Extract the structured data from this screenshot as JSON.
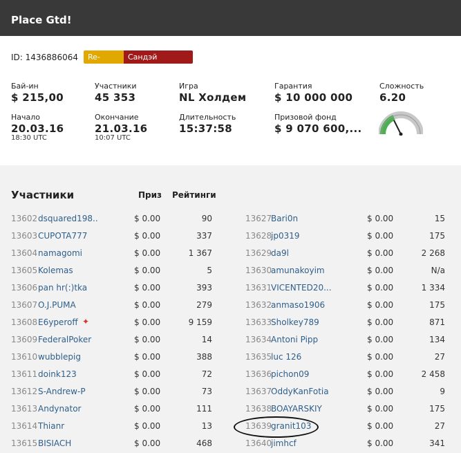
{
  "header": {
    "title": "Place Gtd!"
  },
  "tournament": {
    "id_text": "ID: 1436886064",
    "badges": [
      "Re-entry",
      "Сандэй Миллион"
    ],
    "buyin_label": "Бай-ин",
    "buyin_value": "$ 215,00",
    "players_label": "Участники",
    "players_value": "45 353",
    "game_label": "Игра",
    "game_value": "NL Холдем",
    "guarantee_label": "Гарантия",
    "guarantee_value": "$ 10 000 000",
    "difficulty_label": "Сложность",
    "difficulty_value": "6.20",
    "start_label": "Начало",
    "start_date": "20.03.16",
    "start_time": "18:30 UTC",
    "end_label": "Окончание",
    "end_date": "21.03.16",
    "end_time": "10:07 UTC",
    "duration_label": "Длительность",
    "duration_value": "15:37:58",
    "prizepool_label": "Призовой фонд",
    "prizepool_value": "$ 9 070 600,...",
    "difficulty_fraction": 0.62
  },
  "list": {
    "title": "Участники",
    "prize_header": "Приз",
    "rating_header": "Рейтинги",
    "left": [
      {
        "pos": "13602",
        "name": "dsquared198..",
        "prize": "$ 0.00",
        "rating": "90"
      },
      {
        "pos": "13603",
        "name": "CUPOTA777",
        "prize": "$ 0.00",
        "rating": "337"
      },
      {
        "pos": "13604",
        "name": "namagomi",
        "prize": "$ 0.00",
        "rating": "1 367"
      },
      {
        "pos": "13605",
        "name": "Kolemas",
        "prize": "$ 0.00",
        "rating": "5"
      },
      {
        "pos": "13606",
        "name": "pan hr(:)tka",
        "prize": "$ 0.00",
        "rating": "393"
      },
      {
        "pos": "13607",
        "name": "O.J.PUMA",
        "prize": "$ 0.00",
        "rating": "279"
      },
      {
        "pos": "13608",
        "name": "E6yperoff",
        "prize": "$ 0.00",
        "rating": "9 159"
      },
      {
        "pos": "13609",
        "name": "FederalPoker",
        "prize": "$ 0.00",
        "rating": "14"
      },
      {
        "pos": "13610",
        "name": "wubblepig",
        "prize": "$ 0.00",
        "rating": "388"
      },
      {
        "pos": "13611",
        "name": "doink123",
        "prize": "$ 0.00",
        "rating": "72"
      },
      {
        "pos": "13612",
        "name": "S-Andrew-P",
        "prize": "$ 0.00",
        "rating": "73"
      },
      {
        "pos": "13613",
        "name": "Andynator",
        "prize": "$ 0.00",
        "rating": "111"
      },
      {
        "pos": "13614",
        "name": "Thianr",
        "prize": "$ 0.00",
        "rating": "13"
      },
      {
        "pos": "13615",
        "name": "BISIACH",
        "prize": "$ 0.00",
        "rating": "468"
      }
    ],
    "right": [
      {
        "pos": "13627",
        "name": "Bari0n",
        "prize": "$ 0.00",
        "rating": "15"
      },
      {
        "pos": "13628",
        "name": "jp0319",
        "prize": "$ 0.00",
        "rating": "175"
      },
      {
        "pos": "13629",
        "name": "da9l",
        "prize": "$ 0.00",
        "rating": "2 268"
      },
      {
        "pos": "13630",
        "name": "amunakoyim",
        "prize": "$ 0.00",
        "rating": "N/a"
      },
      {
        "pos": "13631",
        "name": "VICENTED20...",
        "prize": "$ 0.00",
        "rating": "1 334"
      },
      {
        "pos": "13632",
        "name": "anmaso1906",
        "prize": "$ 0.00",
        "rating": "175"
      },
      {
        "pos": "13633",
        "name": "Sholkey789",
        "prize": "$ 0.00",
        "rating": "871"
      },
      {
        "pos": "13634",
        "name": "Antoni Pipp",
        "prize": "$ 0.00",
        "rating": "134"
      },
      {
        "pos": "13635",
        "name": "luc 126",
        "prize": "$ 0.00",
        "rating": "27"
      },
      {
        "pos": "13636",
        "name": "pichon09",
        "prize": "$ 0.00",
        "rating": "2 458"
      },
      {
        "pos": "13637",
        "name": "OddyKanFotia",
        "prize": "$ 0.00",
        "rating": "9"
      },
      {
        "pos": "13638",
        "name": "BOAYARSKIY",
        "prize": "$ 0.00",
        "rating": "175"
      },
      {
        "pos": "13639",
        "name": "granit103",
        "prize": "$ 0.00",
        "rating": "27"
      },
      {
        "pos": "13640",
        "name": "jimhcf",
        "prize": "$ 0.00",
        "rating": "341"
      }
    ]
  },
  "colors": {
    "header_bg": "#393939",
    "reentry": "#e0a800",
    "sunday_million": "#a11a1a",
    "link": "#2f5f8a",
    "gauge_green": "#4caf50"
  },
  "icons": {
    "flag": "canada-flag-icon"
  }
}
